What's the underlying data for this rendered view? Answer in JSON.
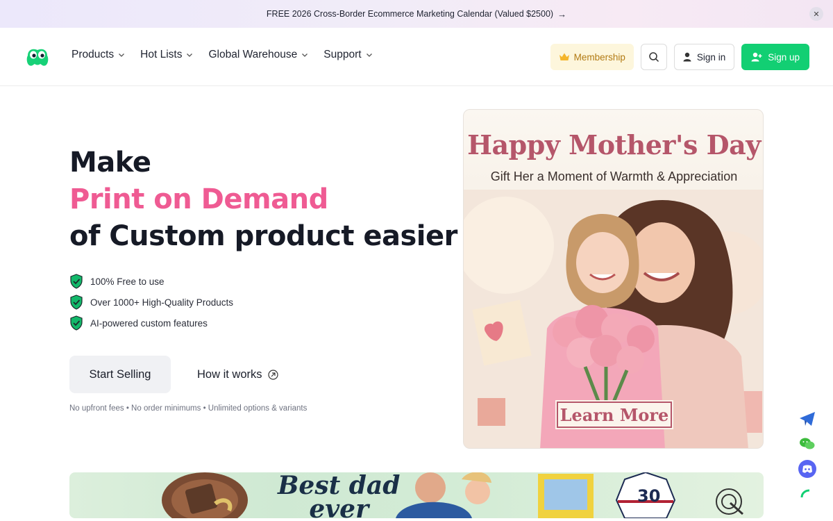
{
  "promo": {
    "text": "FREE 2026 Cross-Border Ecommerce Marketing Calendar (Valued $2500)",
    "arrow": "→",
    "close": "✕"
  },
  "nav": {
    "items": [
      {
        "label": "Products"
      },
      {
        "label": "Hot Lists"
      },
      {
        "label": "Global Warehouse"
      },
      {
        "label": "Support"
      }
    ]
  },
  "header": {
    "membership": "Membership",
    "sign_in": "Sign in",
    "sign_up": "Sign up"
  },
  "hero": {
    "line1": "Make",
    "line2": "Print on Demand",
    "line3": "of Custom product easier",
    "features": [
      "100% Free to use",
      "Over 1000+ High-Quality Products",
      "AI-powered custom features"
    ],
    "start_selling": "Start Selling",
    "how_it_works": "How it works",
    "fineprint": "No upfront fees • No order minimums • Unlimited options & variants"
  },
  "promo_card": {
    "title": "Happy Mother's Day",
    "subtitle": "Gift Her a Moment of Warmth & Appreciation",
    "cta": "Learn More"
  },
  "banner": {
    "line1": "Best dad",
    "line2": "ever",
    "jersey_number": "30"
  },
  "colors": {
    "brand_green": "#12cf73",
    "accent_pink": "#ef5b93",
    "membership_gold": "#b27a13",
    "card_rose": "#b5566a"
  }
}
